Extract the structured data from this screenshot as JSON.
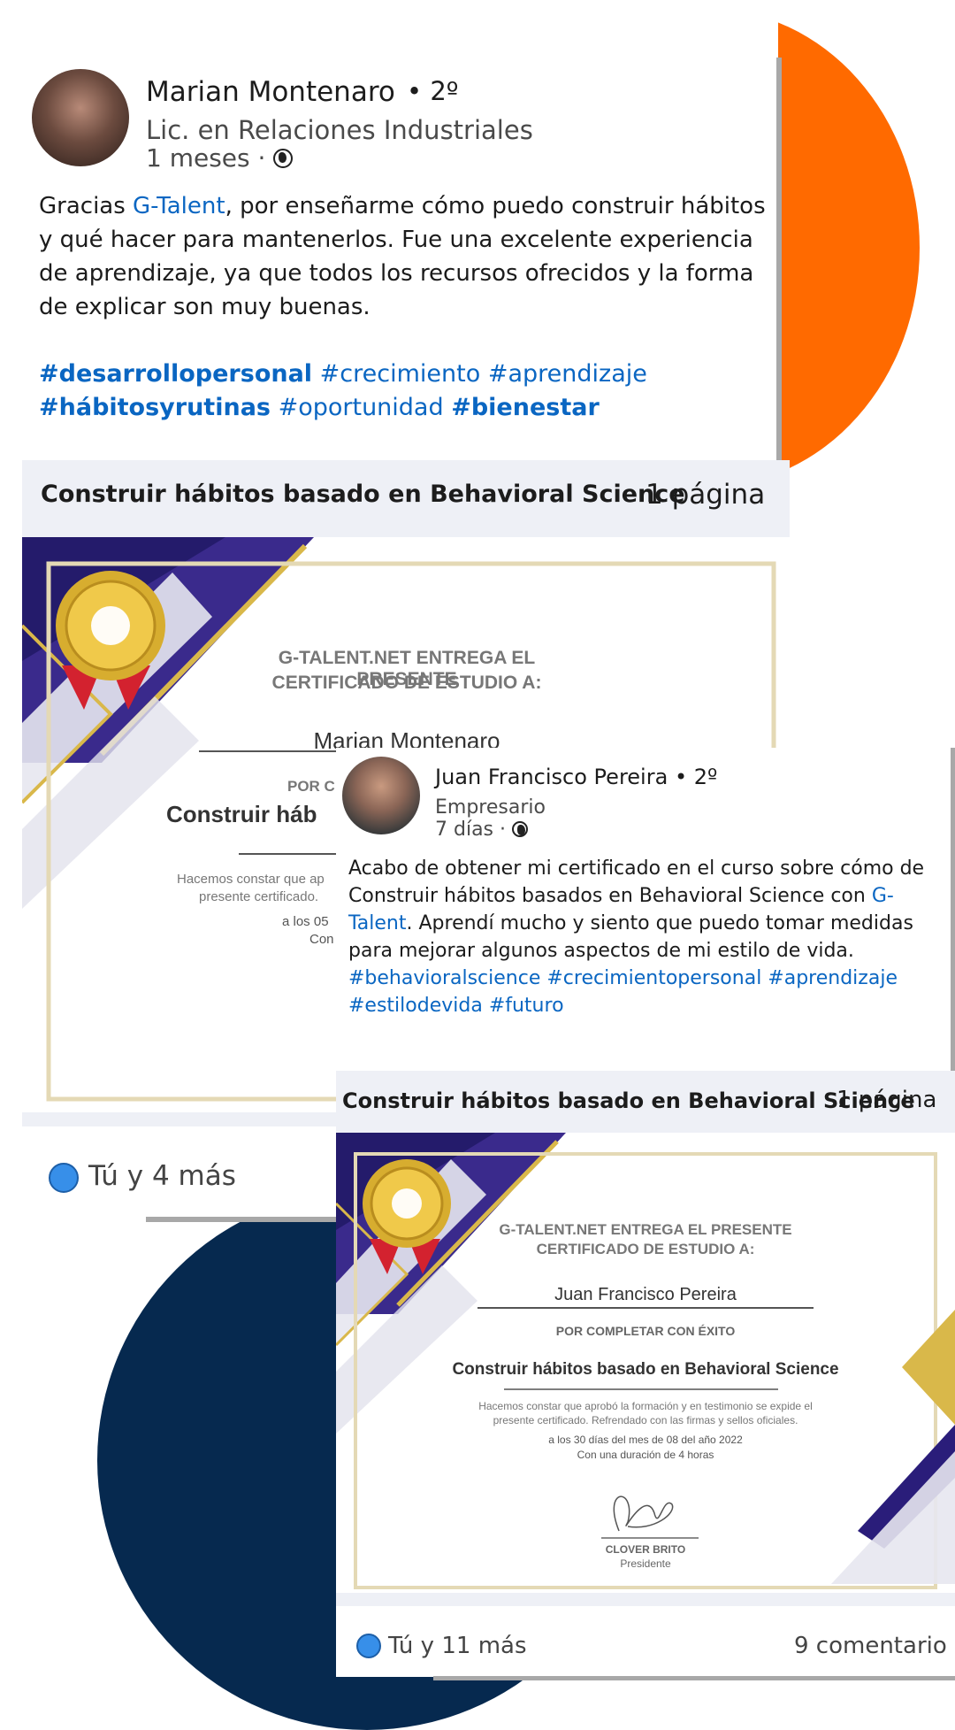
{
  "colors": {
    "orange": "#ff6a00",
    "navy": "#06294f",
    "link": "#0a66c2",
    "gold": "#d9b84a",
    "purple": "#3a2a8c"
  },
  "post1": {
    "author": "Marian Montenaro",
    "degree": "• 2º",
    "headline": "Lic. en Relaciones Industriales",
    "time": "1 meses",
    "text_before": "Gracias ",
    "text_link": "G-Talent",
    "text_after": ", por enseñarme cómo puedo construir hábitos y qué hacer para mantenerlos. Fue una excelente experiencia de aprendizaje, ya que todos los recursos ofrecidos y la forma de explicar son muy buenas.",
    "tags": [
      "#desarrollopersonal",
      "#crecimiento",
      "#aprendizaje",
      "#hábitosyrutinas",
      "#oportunidad",
      "#bienestar"
    ],
    "doc_title": "Construir hábitos basado en Behavioral Science",
    "doc_pages": "1 página",
    "certificate": {
      "issuer": "G-TALENT.NET ENTREGA EL PRESENTE",
      "issuer2": "CERTIFICADO DE ESTUDIO A:",
      "recipient": "Marian Montenaro",
      "por": "POR C",
      "course": "Construir háb",
      "desc1": "Hacemos constar que ap",
      "desc2": "presente certificado.",
      "day": "a los 05",
      "con": "Con"
    },
    "likes": "Tú y",
    "likes_count": "4 más"
  },
  "post2": {
    "author": "Juan Francisco Pereira",
    "degree": "• 2º",
    "headline": "Empresario",
    "time": "7 días",
    "text_before": "Acabo de obtener mi certificado en el curso sobre cómo de Construir hábitos basados en Behavioral Science con ",
    "text_link": "G-Talent",
    "text_after": ". Aprendí mucho y siento que puedo tomar medidas para mejorar algunos aspectos de mi estilo de vida.",
    "tags": "#behavioralscience #crecimientopersonal #aprendizaje #estilodevida #futuro",
    "doc_title": "Construir hábitos basado en Behavioral Science",
    "doc_pages": "1 página",
    "certificate": {
      "issuer": "G-TALENT.NET ENTREGA EL PRESENTE",
      "issuer2": "CERTIFICADO DE ESTUDIO A:",
      "recipient": "Juan Francisco Pereira",
      "por": "POR COMPLETAR CON ÉXITO",
      "course": "Construir hábitos basado en Behavioral Science",
      "desc1": "Hacemos constar que aprobó la formación y en testimonio se expide el",
      "desc2": "presente certificado. Refrendado con las firmas y sellos oficiales.",
      "date": "a los 30 días del mes de 08 del año 2022",
      "duration": "Con una duración de 4 horas",
      "signer": "CLOVER BRITO",
      "signer_role": "Presidente"
    },
    "likes": "Tú y",
    "likes_count": "11 más",
    "comments": "9 comentario"
  }
}
